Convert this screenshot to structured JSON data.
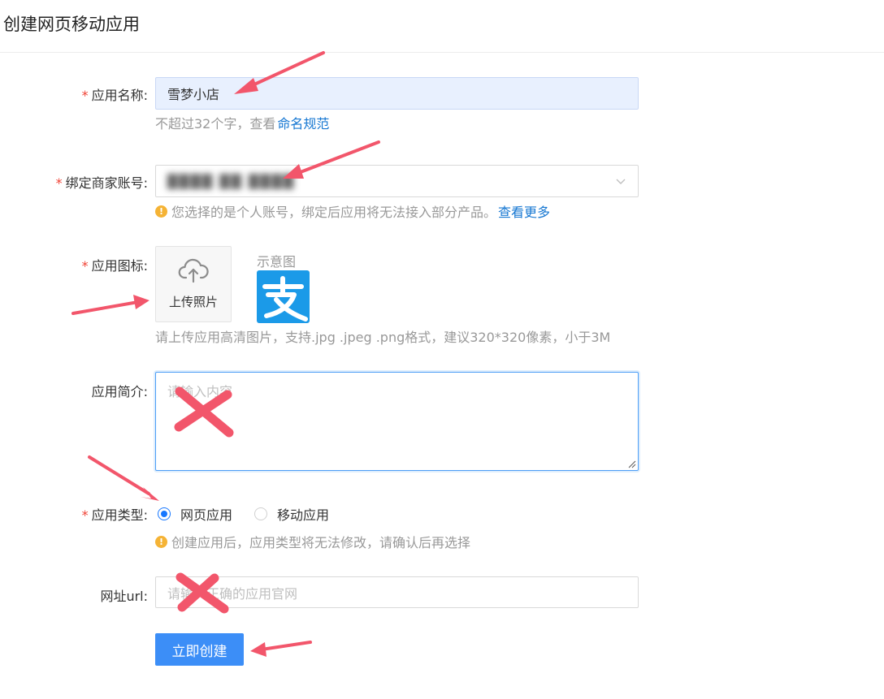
{
  "page": {
    "title": "创建网页移动应用"
  },
  "form": {
    "required_mark": "*",
    "app_name": {
      "label": "应用名称:",
      "value": "雪梦小店",
      "help_text": "不超过32个字，查看",
      "help_link": "命名规范"
    },
    "merchant_account": {
      "label": "绑定商家账号:",
      "value_obscured": "████ ██ ████",
      "warning_text": "您选择的是个人账号，绑定后应用将无法接入部分产品。",
      "warning_link": "查看更多"
    },
    "app_icon": {
      "label": "应用图标:",
      "upload_label": "上传照片",
      "sample_label": "示意图",
      "sample_glyph": "支",
      "help_text": "请上传应用高清图片，支持.jpg .jpeg .png格式，建议320*320像素，小于3M"
    },
    "app_intro": {
      "label": "应用简介:",
      "placeholder": "请输入内容"
    },
    "app_type": {
      "label": "应用类型:",
      "options": [
        "网页应用",
        "移动应用"
      ],
      "selected": "网页应用",
      "warning_text": "创建应用后，应用类型将无法修改，请确认后再选择"
    },
    "url": {
      "label": "网址url:",
      "placeholder": "请输入正确的应用官网"
    },
    "submit_label": "立即创建",
    "warning_glyph": "!"
  },
  "colors": {
    "primary": "#3c8ef7",
    "link": "#1677d2",
    "required": "#f04134",
    "warning": "#f5b335",
    "annotation": "#f2566b",
    "alipay_blue": "#1b9ae8"
  },
  "icons": {
    "dropdown": "chevron-down-icon",
    "upload": "cloud-upload-icon",
    "warning": "warning-circle-icon",
    "sample": "alipay-logo"
  }
}
